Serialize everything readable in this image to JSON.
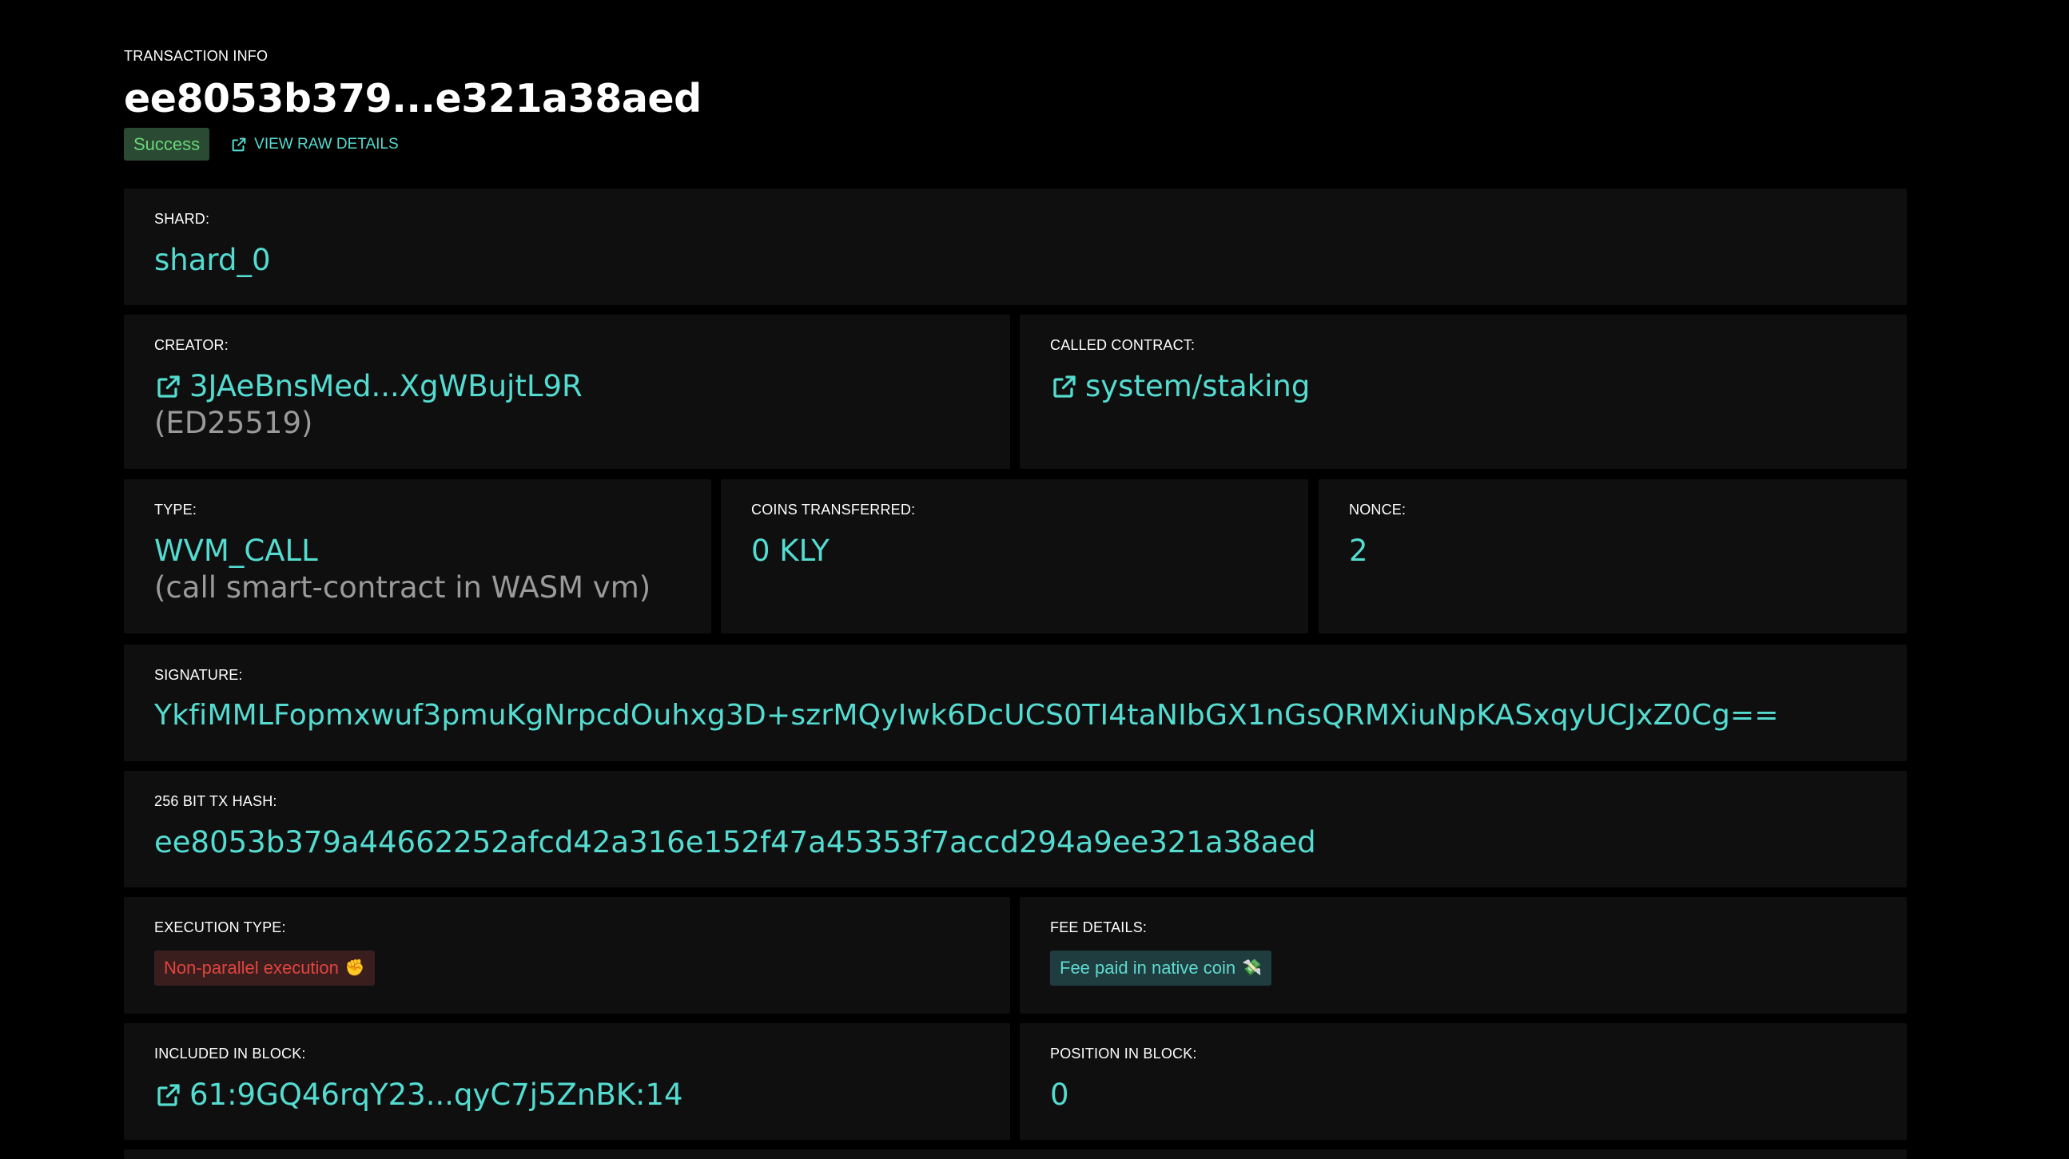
{
  "header": {
    "eyebrow": "TRANSACTION INFO",
    "title": "ee8053b379...e321a38aed",
    "status": "Success",
    "raw_link": "VIEW RAW DETAILS"
  },
  "cards": {
    "shard": {
      "label": "SHARD:",
      "value": "shard_0"
    },
    "creator": {
      "label": "CREATOR:",
      "value": "3JAeBnsMed...XgWBujtL9R",
      "sub": "(ED25519)"
    },
    "called_contract": {
      "label": "CALLED CONTRACT:",
      "value": "system/staking"
    },
    "type": {
      "label": "TYPE:",
      "value": "WVM_CALL",
      "sub": "(call smart-contract in WASM vm)"
    },
    "coins": {
      "label": "COINS TRANSFERRED:",
      "value": "0 KLY"
    },
    "nonce": {
      "label": "NONCE:",
      "value": "2"
    },
    "signature": {
      "label": "SIGNATURE:",
      "value": "YkfiMMLFopmxwuf3pmuKgNrpcdOuhxg3D+szrMQyIwk6DcUCS0TI4taNIbGX1nGsQRMXiuNpKASxqyUCJxZ0Cg=="
    },
    "hash": {
      "label": "256 BIT TX HASH:",
      "value": "ee8053b379a44662252afcd42a316e152f47a45353f7accd294a9ee321a38aed"
    },
    "execution": {
      "label": "EXECUTION TYPE:",
      "value": "Non-parallel execution",
      "emoji": "✊"
    },
    "fee": {
      "label": "FEE DETAILS:",
      "value": "Fee paid in native coin",
      "emoji": "💸"
    },
    "block": {
      "label": "INCLUDED IN BLOCK:",
      "value": "61:9GQ46rqY23...qyC7j5ZnBK:14"
    },
    "position": {
      "label": "POSITION IN BLOCK:",
      "value": "0"
    }
  },
  "colors": {
    "background": "#000000",
    "card": "#0f0f0f",
    "accent": "#54dcd1",
    "muted": "#9a9a9a",
    "success_bg": "#2a4a33",
    "success_text": "#6ad67a",
    "error_bg": "#3a1e1e",
    "error_text": "#e0443f"
  },
  "icons": [
    "external-link-icon",
    "fist-emoji-icon",
    "money-wings-emoji-icon"
  ]
}
